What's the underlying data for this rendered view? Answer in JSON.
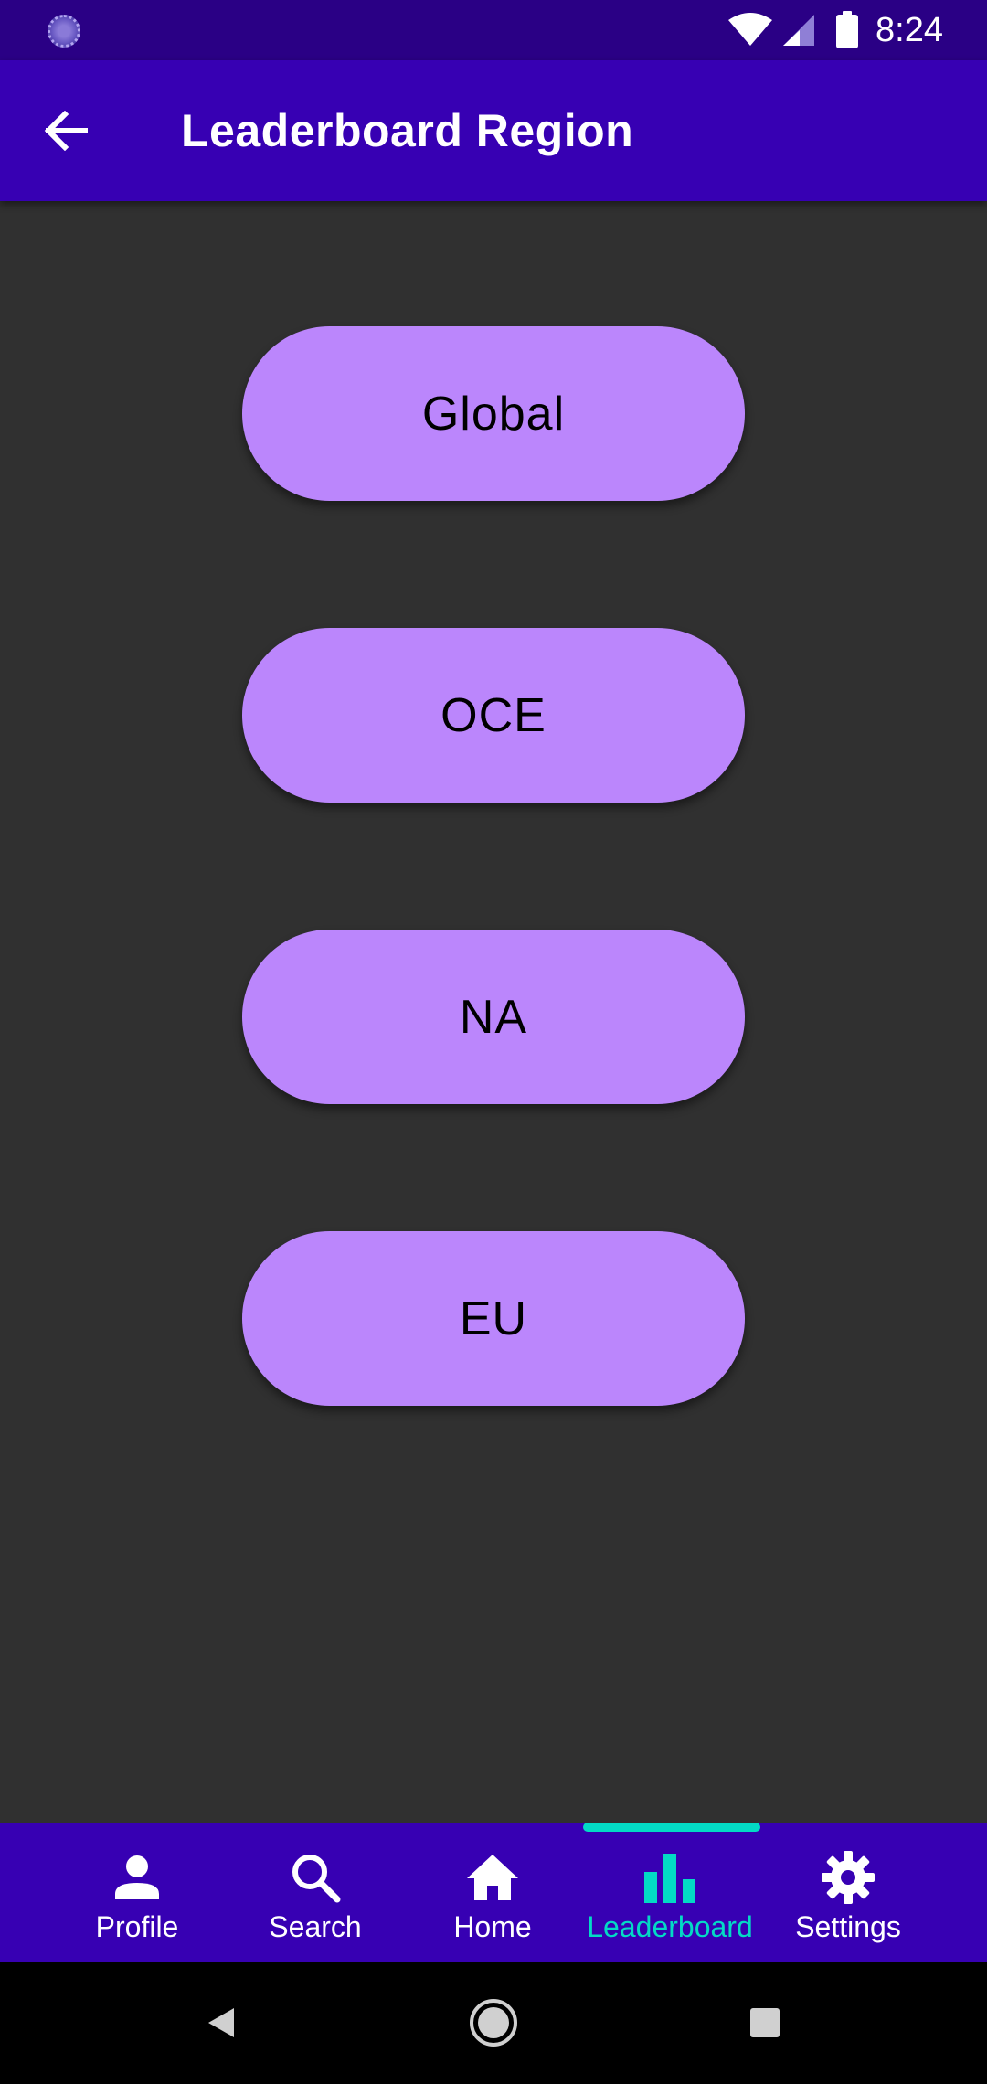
{
  "status_bar": {
    "time": "8:24",
    "icons": [
      "app-indicator-icon",
      "wifi-icon",
      "signal-icon",
      "battery-icon"
    ]
  },
  "app_bar": {
    "title": "Leaderboard Region",
    "back_icon": "arrow-back-icon"
  },
  "regions": [
    {
      "label": "Global"
    },
    {
      "label": "OCE"
    },
    {
      "label": "NA"
    },
    {
      "label": "EU"
    }
  ],
  "bottom_nav": {
    "items": [
      {
        "label": "Profile",
        "icon": "person-icon"
      },
      {
        "label": "Search",
        "icon": "search-icon"
      },
      {
        "label": "Home",
        "icon": "home-icon"
      },
      {
        "label": "Leaderboard",
        "icon": "bar-chart-icon",
        "active": true
      },
      {
        "label": "Settings",
        "icon": "gear-icon"
      }
    ]
  },
  "system_nav": {
    "icons": [
      "back-triangle-icon",
      "home-circle-icon",
      "recents-square-icon"
    ]
  },
  "colors": {
    "status_bar": "#2A0085",
    "primary": "#3700B3",
    "background": "#303030",
    "button": "#BB86FC",
    "accent": "#03DAC5"
  }
}
